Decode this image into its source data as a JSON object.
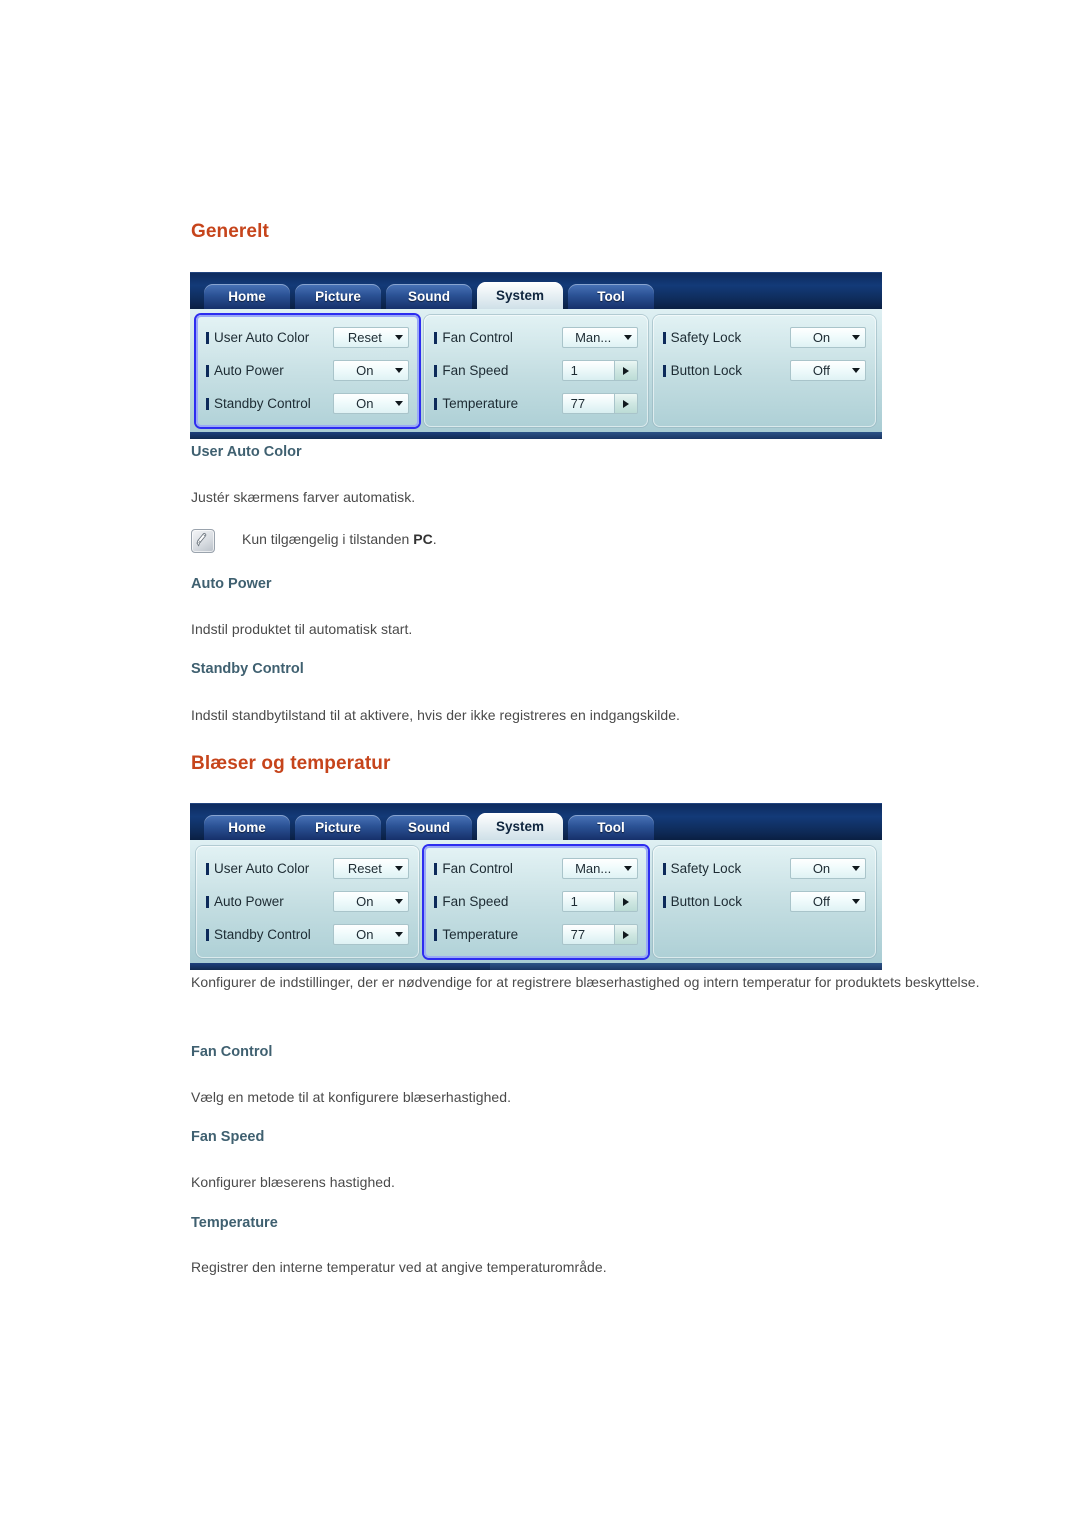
{
  "sections": [
    {
      "heading": "Generelt",
      "osd": {
        "tabs": [
          {
            "label": "Home",
            "active": false
          },
          {
            "label": "Picture",
            "active": false
          },
          {
            "label": "Sound",
            "active": false
          },
          {
            "label": "System",
            "active": true
          },
          {
            "label": "Tool",
            "active": false
          }
        ],
        "selected_group": 0,
        "groups": [
          {
            "rows": [
              {
                "label": "User Auto Color",
                "control": "dropdown",
                "value": "Reset"
              },
              {
                "label": "Auto Power",
                "control": "dropdown",
                "value": "On"
              },
              {
                "label": "Standby Control",
                "control": "dropdown",
                "value": "On"
              }
            ]
          },
          {
            "rows": [
              {
                "label": "Fan Control",
                "control": "dropdown",
                "value": "Man..."
              },
              {
                "label": "Fan Speed",
                "control": "spinner",
                "value": "1"
              },
              {
                "label": "Temperature",
                "control": "spinner",
                "value": "77"
              }
            ]
          },
          {
            "rows": [
              {
                "label": "Safety Lock",
                "control": "dropdown",
                "value": "On"
              },
              {
                "label": "Button Lock",
                "control": "dropdown",
                "value": "Off"
              }
            ]
          }
        ]
      },
      "entries": [
        {
          "title": "User Auto Color",
          "body": "Justér skærmens farver automatisk.",
          "note": {
            "icon": "note-pencil-icon",
            "text_before": "Kun tilgængelig i tilstanden ",
            "bold": "PC",
            "text_after": "."
          }
        },
        {
          "title": "Auto Power",
          "body": "Indstil produktet til automatisk start."
        },
        {
          "title": "Standby Control",
          "body": "Indstil standbytilstand til at aktivere, hvis der ikke registreres en indgangskilde."
        }
      ]
    },
    {
      "heading": "Blæser og temperatur",
      "osd": {
        "tabs": [
          {
            "label": "Home",
            "active": false
          },
          {
            "label": "Picture",
            "active": false
          },
          {
            "label": "Sound",
            "active": false
          },
          {
            "label": "System",
            "active": true
          },
          {
            "label": "Tool",
            "active": false
          }
        ],
        "selected_group": 1,
        "groups": [
          {
            "rows": [
              {
                "label": "User Auto Color",
                "control": "dropdown",
                "value": "Reset"
              },
              {
                "label": "Auto Power",
                "control": "dropdown",
                "value": "On"
              },
              {
                "label": "Standby Control",
                "control": "dropdown",
                "value": "On"
              }
            ]
          },
          {
            "rows": [
              {
                "label": "Fan Control",
                "control": "dropdown",
                "value": "Man..."
              },
              {
                "label": "Fan Speed",
                "control": "spinner",
                "value": "1"
              },
              {
                "label": "Temperature",
                "control": "spinner",
                "value": "77"
              }
            ]
          },
          {
            "rows": [
              {
                "label": "Safety Lock",
                "control": "dropdown",
                "value": "On"
              },
              {
                "label": "Button Lock",
                "control": "dropdown",
                "value": "Off"
              }
            ]
          }
        ]
      },
      "intro": "Konfigurer de indstillinger, der er nødvendige for at registrere blæserhastighed og intern temperatur for produktets beskyttelse.",
      "entries": [
        {
          "title": "Fan Control",
          "body": "Vælg en metode til at konfigurere blæserhastighed."
        },
        {
          "title": "Fan Speed",
          "body": "Konfigurer blæserens hastighed."
        },
        {
          "title": "Temperature",
          "body": "Registrer den interne temperatur ved at angive temperaturområde."
        }
      ]
    }
  ],
  "colors": {
    "heading": "#c6441b",
    "subheading": "#3f6070",
    "body": "#4a4a4a",
    "selection_border": "#2d2df0",
    "tabbar": "#10294f"
  }
}
